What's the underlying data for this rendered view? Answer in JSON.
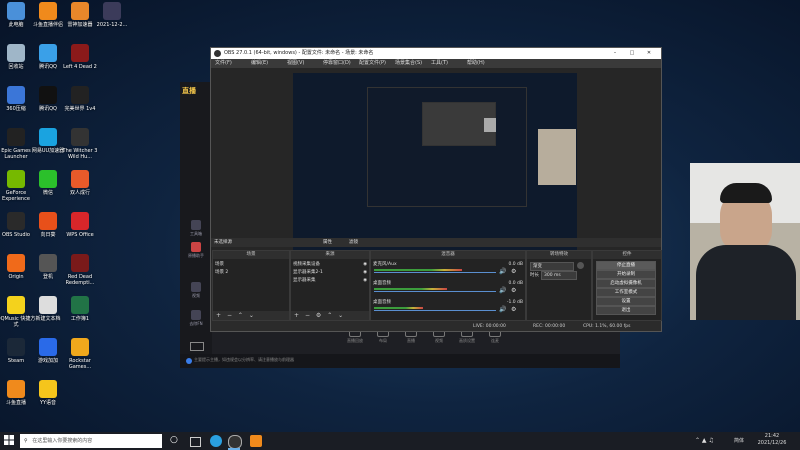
{
  "desktop": {
    "icons": [
      {
        "label": "此电脑",
        "color": "#4a90d9"
      },
      {
        "label": "斗鱼直播伴侣",
        "color": "#f08a1c"
      },
      {
        "label": "雷神加速器",
        "color": "#e8872a"
      },
      {
        "label": "2021-12-2...",
        "color": "#3b3b5a"
      },
      {
        "label": "回收站",
        "color": "#9fb6c8"
      },
      {
        "label": "腾讯QQ",
        "color": "#3aa0e8"
      },
      {
        "label": "Left 4 Dead 2",
        "color": "#8b1a1a"
      },
      {
        "label": "360压缩",
        "color": "#3b76d8"
      },
      {
        "label": "腾讯QQ",
        "color": "#111111"
      },
      {
        "label": "完美世界 1v4",
        "color": "#222222"
      },
      {
        "label": "Epic Games Launcher",
        "color": "#222222"
      },
      {
        "label": "网易UU加速器",
        "color": "#1aa3e0"
      },
      {
        "label": "The Witcher 3 Wild Hu...",
        "color": "#333333"
      },
      {
        "label": "GeForce Experience",
        "color": "#76b900"
      },
      {
        "label": "微信",
        "color": "#2bc02b"
      },
      {
        "label": "双人成行",
        "color": "#e85a2a"
      },
      {
        "label": "OBS Studio",
        "color": "#2a2a2a"
      },
      {
        "label": "向日葵",
        "color": "#e8501a"
      },
      {
        "label": "WPS Office",
        "color": "#d8262a"
      },
      {
        "label": "Origin",
        "color": "#f06a1a"
      },
      {
        "label": "登机",
        "color": "#555555"
      },
      {
        "label": "Red Dead Redempti...",
        "color": "#7a1a1a"
      },
      {
        "label": "QQMusic 快捷方式",
        "color": "#f4d21c"
      },
      {
        "label": "新建文本档",
        "color": "#dddddd"
      },
      {
        "label": "工作簿1",
        "color": "#217346"
      },
      {
        "label": "Steam",
        "color": "#1b2838"
      },
      {
        "label": "游戏加加",
        "color": "#2a6ae8"
      },
      {
        "label": "Rockstar Games...",
        "color": "#f0a81c"
      },
      {
        "label": "斗鱼直播",
        "color": "#f08a1c"
      },
      {
        "label": "YY语音",
        "color": "#f5c51c"
      }
    ]
  },
  "bg_app": {
    "logo_text": "直播",
    "sidebar": [
      "工具箱",
      "原播助手",
      "视频",
      "去除FN"
    ],
    "tools": [
      "直播回放",
      "布局",
      "直播",
      "视频",
      "画质设置",
      "连麦"
    ],
    "status_text": "主要提示主播，如违规会以分辨率、请注意播放与前理器"
  },
  "obs": {
    "title": "OBS 27.0.1 (64-bit, windows) - 配置文件: 未命名 - 场景: 未命名",
    "menus": [
      "文件(F)",
      "编辑(E)",
      "视图(V)",
      "停靠窗口(D)",
      "配置文件(P)",
      "场景集合(S)",
      "工具(T)",
      "帮助(H)"
    ],
    "preview_label": "未选择源",
    "props_button": "属性",
    "filters_button": "滤镜",
    "scenes": {
      "header": "场景",
      "items": [
        "场景",
        "场景 2"
      ]
    },
    "sources": {
      "header": "来源",
      "items": [
        "视频采集设备",
        "显示器采集2-1",
        "显示器采集"
      ]
    },
    "mixer": {
      "header": "混音器",
      "tracks": [
        {
          "name": "麦克风/Aux",
          "db": "0.0 dB",
          "level": 0.72
        },
        {
          "name": "桌面音频",
          "db": "0.0 dB",
          "level": 0.6
        },
        {
          "name": "桌面音频",
          "db": "-1.0 dB",
          "level": 0.4
        }
      ]
    },
    "transitions": {
      "header": "转场特效",
      "type": "渐变",
      "duration_label": "时长",
      "duration": "300 ms"
    },
    "controls": {
      "header": "控件",
      "buttons": [
        "停止直播",
        "开始录制",
        "启动虚拟摄像机",
        "工作室模式",
        "设置",
        "退出"
      ]
    },
    "status": {
      "live": "LIVE: 00:00:00",
      "rec": "REC: 00:00:00",
      "cpu": "CPU: 1.1%, 60.00 fps"
    }
  },
  "taskbar": {
    "search_placeholder": "在这里输入你要搜索的内容",
    "time": "21:42",
    "date": "2021/12/26",
    "ime": "简体"
  }
}
